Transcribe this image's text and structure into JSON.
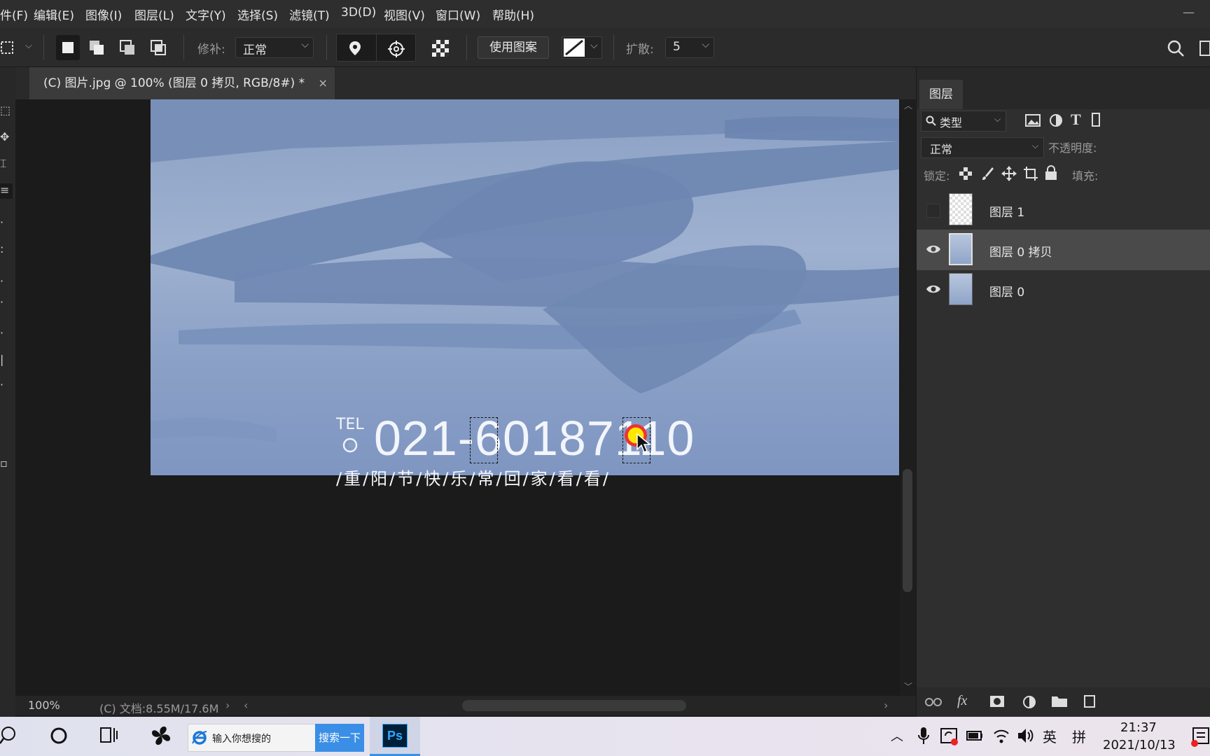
{
  "menu": [
    {
      "name": "menu-file",
      "label": "件(F)"
    },
    {
      "name": "menu-edit",
      "label": "编辑(E)"
    },
    {
      "name": "menu-image",
      "label": "图像(I)"
    },
    {
      "name": "menu-layer",
      "label": "图层(L)"
    },
    {
      "name": "menu-type",
      "label": "文字(Y)"
    },
    {
      "name": "menu-select",
      "label": "选择(S)"
    },
    {
      "name": "menu-filter",
      "label": "滤镜(T)"
    },
    {
      "name": "menu-3d",
      "label": "3D(D)"
    },
    {
      "name": "menu-view",
      "label": "视图(V)"
    },
    {
      "name": "menu-window",
      "label": "窗口(W)"
    },
    {
      "name": "menu-help",
      "label": "帮助(H)"
    }
  ],
  "options": {
    "patch_label": "修补:",
    "patch_mode": "正常",
    "use_pattern": "使用图案",
    "diffusion_label": "扩散:",
    "diffusion_value": "5"
  },
  "document": {
    "tab_title": "(C) 图片.jpg @ 100% (图层 0 拷贝, RGB/8#) *",
    "close": "×",
    "tel_label": "TEL",
    "phone": "021-60187110",
    "slogan": "/重/阳/节/快/乐/常/回/家/看/看/"
  },
  "status": {
    "zoom": "100%",
    "doc_info": "(C) 文档:8.55M/17.6M"
  },
  "layers_panel": {
    "tab": "图层",
    "filter_kind": "类型",
    "blend_mode": "正常",
    "opacity_label": "不透明度:",
    "lock_label": "锁定:",
    "fill_label": "填充:",
    "layers": [
      {
        "name": "图层 1",
        "visible": false,
        "thumb": "transparent",
        "active": false
      },
      {
        "name": "图层 0 拷贝",
        "visible": true,
        "thumb": "image",
        "active": true
      },
      {
        "name": "图层 0",
        "visible": true,
        "thumb": "image",
        "active": false
      }
    ]
  },
  "taskbar": {
    "search_placeholder": "输入你想搜的",
    "search_button": "搜索一下",
    "ps_label": "Ps",
    "ime_lang": "英",
    "ime_mode": "拼",
    "time": "21:37",
    "date": "2021/10/13"
  },
  "colors": {
    "accent": "#3a8ee6",
    "ps_blue": "#31a8ff",
    "image_sky": "#8aa0c4"
  }
}
